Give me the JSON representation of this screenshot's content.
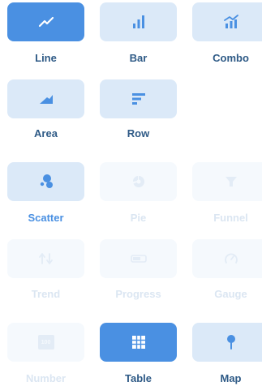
{
  "colors": {
    "selected_bg": "#4a90e2",
    "normal_bg": "#dbe9f8",
    "disabled_bg": "#f5f9fd",
    "icon_normal": "#4a90e2",
    "icon_disabled": "#e3ecf6",
    "label_normal": "#2e5a86",
    "label_disabled": "#dbe6f2"
  },
  "chart_types": [
    {
      "id": "line",
      "label": "Line",
      "icon": "line-chart-icon",
      "state": "selected"
    },
    {
      "id": "bar",
      "label": "Bar",
      "icon": "bar-chart-icon",
      "state": "normal"
    },
    {
      "id": "combo",
      "label": "Combo",
      "icon": "combo-chart-icon",
      "state": "normal"
    },
    {
      "id": "area",
      "label": "Area",
      "icon": "area-chart-icon",
      "state": "normal"
    },
    {
      "id": "row",
      "label": "Row",
      "icon": "row-chart-icon",
      "state": "normal"
    },
    {
      "id": "scatter",
      "label": "Scatter",
      "icon": "scatter-chart-icon",
      "state": "normal"
    },
    {
      "id": "pie",
      "label": "Pie",
      "icon": "pie-chart-icon",
      "state": "disabled"
    },
    {
      "id": "funnel",
      "label": "Funnel",
      "icon": "funnel-icon",
      "state": "disabled"
    },
    {
      "id": "trend",
      "label": "Trend",
      "icon": "trend-icon",
      "state": "disabled"
    },
    {
      "id": "progress",
      "label": "Progress",
      "icon": "progress-icon",
      "state": "disabled"
    },
    {
      "id": "gauge",
      "label": "Gauge",
      "icon": "gauge-icon",
      "state": "disabled"
    },
    {
      "id": "number",
      "label": "Number",
      "icon": "number-icon",
      "state": "disabled",
      "icon_text": "100"
    },
    {
      "id": "table",
      "label": "Table",
      "icon": "table-icon",
      "state": "selected"
    },
    {
      "id": "map",
      "label": "Map",
      "icon": "map-pin-icon",
      "state": "normal"
    }
  ]
}
